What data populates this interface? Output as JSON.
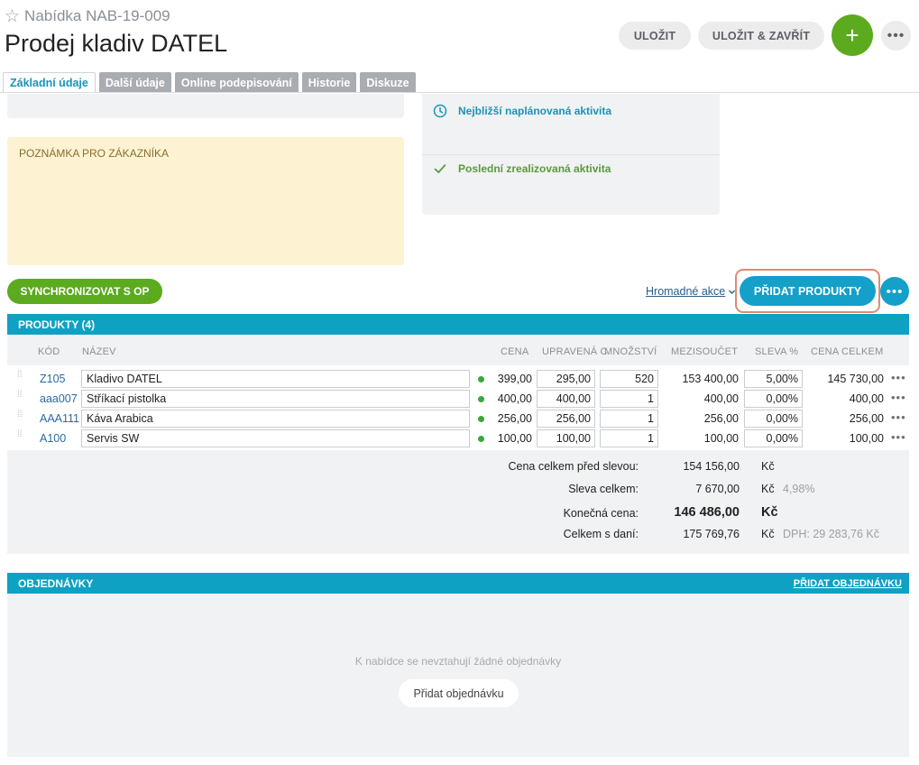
{
  "header": {
    "record_number": "Nabídka NAB-19-009",
    "title": "Prodej kladiv DATEL",
    "save_label": "ULOŽIT",
    "save_close_label": "ULOŽIT & ZAVŘÍT",
    "add_symbol": "+",
    "more_symbol": "•••"
  },
  "tabs": [
    {
      "label": "Základní údaje",
      "active": true
    },
    {
      "label": "Další údaje",
      "active": false
    },
    {
      "label": "Online podepisování",
      "active": false
    },
    {
      "label": "Historie",
      "active": false
    },
    {
      "label": "Diskuze",
      "active": false
    }
  ],
  "note": {
    "label": "POZNÁMKA PRO ZÁKAZNÍKA"
  },
  "activity": {
    "next_label": "Nejbližší naplánovaná aktivita",
    "last_label": "Poslední zrealizovaná aktivita"
  },
  "actions": {
    "sync_label": "SYNCHRONIZOVAT S OP",
    "bulk_label": "Hromadné akce",
    "add_products_label": "PŘIDAT PRODUKTY"
  },
  "products": {
    "header": "PRODUKTY (4)",
    "columns": {
      "code": "KÓD",
      "name": "NÁZEV",
      "price": "CENA",
      "adjusted": "UPRAVENÁ C",
      "qty": "MNOŽSTVÍ",
      "subtotal": "MEZISOUČET",
      "discount": "SLEVA %",
      "total": "CENA CELKEM"
    },
    "rows": [
      {
        "code": "Z105",
        "name": "Kladivo DATEL",
        "price": "399,00",
        "adjusted": "295,00",
        "qty": "520",
        "subtotal": "153 400,00",
        "discount": "5,00%",
        "total": "145 730,00"
      },
      {
        "code": "aaa007",
        "name": "Stříkací pistolka",
        "price": "400,00",
        "adjusted": "400,00",
        "qty": "1",
        "subtotal": "400,00",
        "discount": "0,00%",
        "total": "400,00"
      },
      {
        "code": "AAA111",
        "name": "Káva Arabica",
        "price": "256,00",
        "adjusted": "256,00",
        "qty": "1",
        "subtotal": "256,00",
        "discount": "0,00%",
        "total": "256,00"
      },
      {
        "code": "A100",
        "name": "Servis SW",
        "price": "100,00",
        "adjusted": "100,00",
        "qty": "1",
        "subtotal": "100,00",
        "discount": "0,00%",
        "total": "100,00"
      }
    ]
  },
  "summary": {
    "before_discount_label": "Cena celkem před slevou:",
    "before_discount_value": "154 156,00",
    "discount_label": "Sleva celkem:",
    "discount_value": "7 670,00",
    "discount_pct": "4,98%",
    "final_label": "Konečná cena:",
    "final_value": "146 486,00",
    "with_tax_label": "Celkem s daní:",
    "with_tax_value": "175 769,76",
    "vat": "DPH: 29 283,76 Kč",
    "currency": "Kč"
  },
  "orders": {
    "header": "OBJEDNÁVKY",
    "add_link": "PŘIDAT OBJEDNÁVKU",
    "empty_message": "K nabídce se nevztahují žádné objednávky",
    "add_button": "Přidat objednávku"
  },
  "colors": {
    "accent": "#0fa1c4",
    "green": "#5cab1e",
    "note_bg": "#fdf3d3"
  }
}
